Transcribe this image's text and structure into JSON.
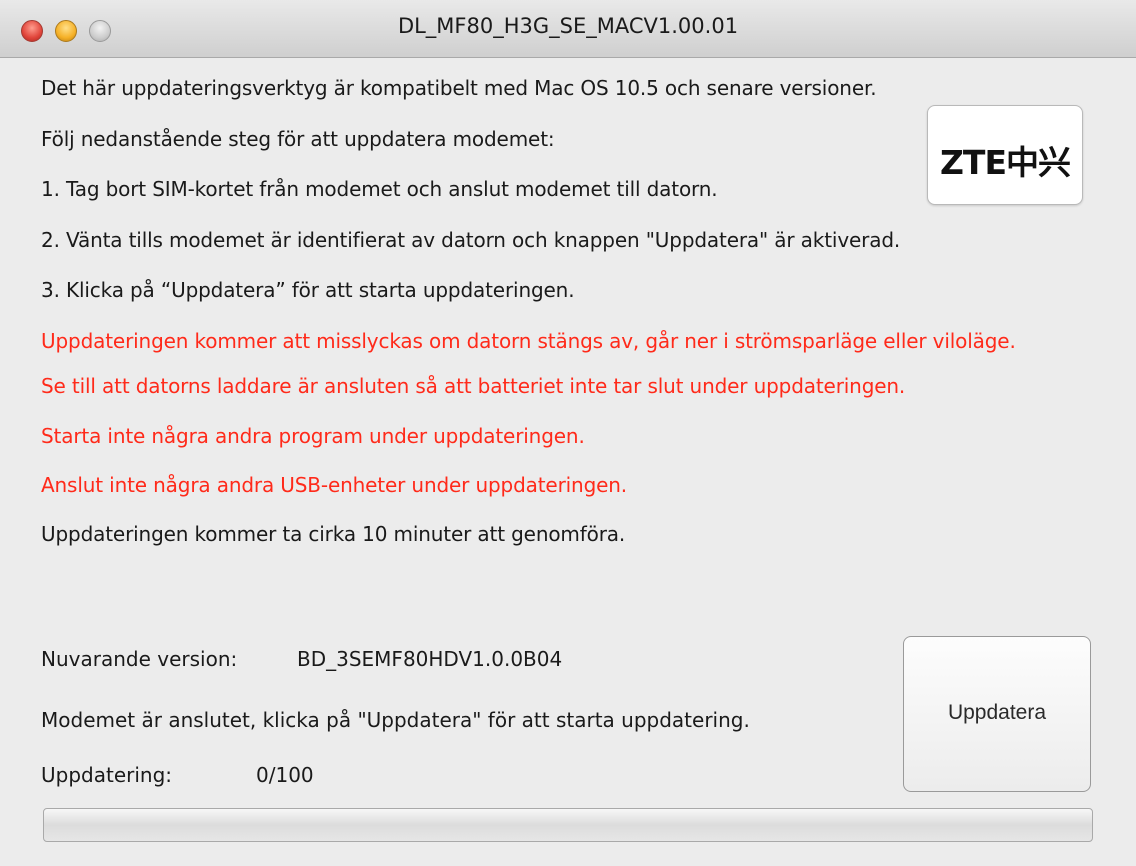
{
  "window": {
    "title": "DL_MF80_H3G_SE_MACV1.00.01"
  },
  "intro": {
    "compatibility": "Det här uppdateringsverktyg är kompatibelt med Mac OS 10.5 och senare versioner.",
    "steps_heading": "Följ nedanstående steg för att uppdatera modemet:",
    "step1": "1. Tag bort SIM-kortet från modemet och anslut modemet till datorn.",
    "step2": "2. Vänta tills modemet är identifierat av datorn och knappen \"Uppdatera\" är aktiverad.",
    "step3": "3.  Klicka på “Uppdatera” för att starta uppdateringen."
  },
  "warnings": {
    "w1": "Uppdateringen kommer att misslyckas om datorn stängs av, går ner i strömsparläge eller viloläge.",
    "w2": "Se till att datorns laddare är ansluten så att batteriet inte tar slut under uppdateringen.",
    "w3": "Starta inte några andra program under uppdateringen.",
    "w4": "Anslut inte några andra USB-enheter under uppdateringen."
  },
  "duration_note": "Uppdateringen kommer ta cirka 10 minuter att genomföra.",
  "logo": {
    "text": "ZTE中兴"
  },
  "status": {
    "version_label": "Nuvarande version:",
    "version_value": "BD_3SEMF80HDV1.0.0B04",
    "message": "Modemet är anslutet, klicka på \"Uppdatera\" för att starta uppdatering.",
    "progress_label": "Uppdatering:",
    "progress_value": "0/100",
    "progress_fraction": 0
  },
  "buttons": {
    "update_label": "Uppdatera"
  },
  "colors": {
    "warning_text": "#ff2a1a",
    "window_background": "#ececec"
  }
}
